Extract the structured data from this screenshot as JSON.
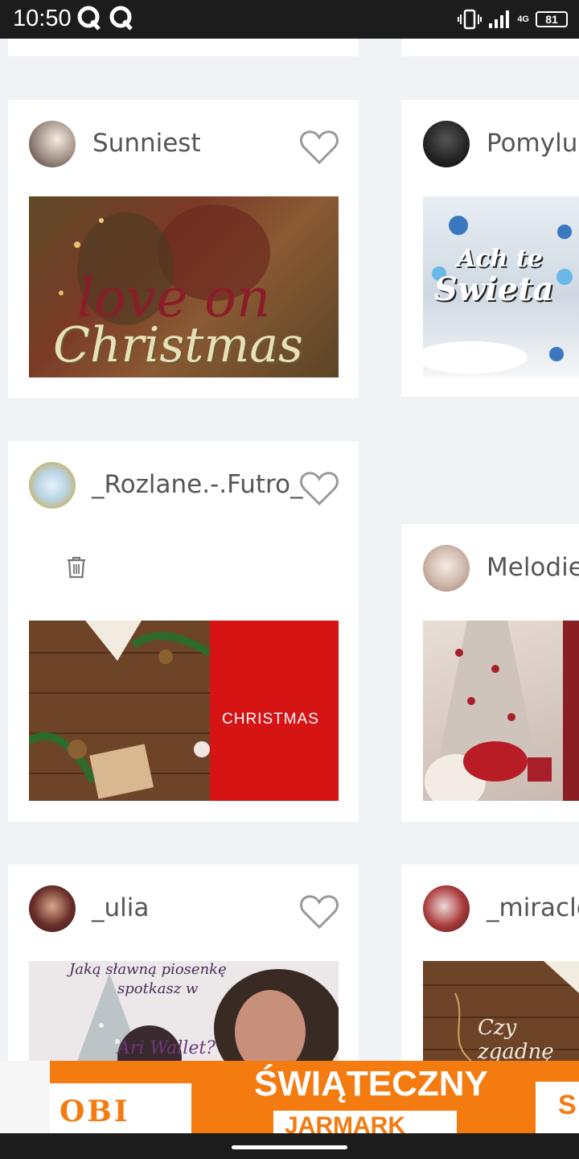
{
  "status_bar": {
    "time": "10:50",
    "network": "4G",
    "battery": "81"
  },
  "cards": [
    {
      "username": "Sunniest",
      "cover_text_1": "love on",
      "cover_text_2": "Christmas"
    },
    {
      "username": "Pomylun",
      "cover_text_1": "Ach te",
      "cover_text_2": "Swieta"
    },
    {
      "username": "_Rozlane.-.Futro_",
      "cover_text_1": "CHRISTMAS"
    },
    {
      "username": "Melodie"
    },
    {
      "username": "_ulia",
      "cover_text_1": "Jaką sławną piosenkę",
      "cover_text_2": "spotkasz w",
      "cover_text_3": "Ari Wallet?"
    },
    {
      "username": "_miracle",
      "cover_text_1": "Czy zgadnę"
    }
  ],
  "ad": {
    "brand": "OBI",
    "headline": "ŚWIĄTECZNY",
    "subline": "JARMARK",
    "edge_text": "S"
  },
  "colors": {
    "background": "#f0f2f5",
    "ad_orange": "#f47b10",
    "christmas_red": "#d71414"
  }
}
